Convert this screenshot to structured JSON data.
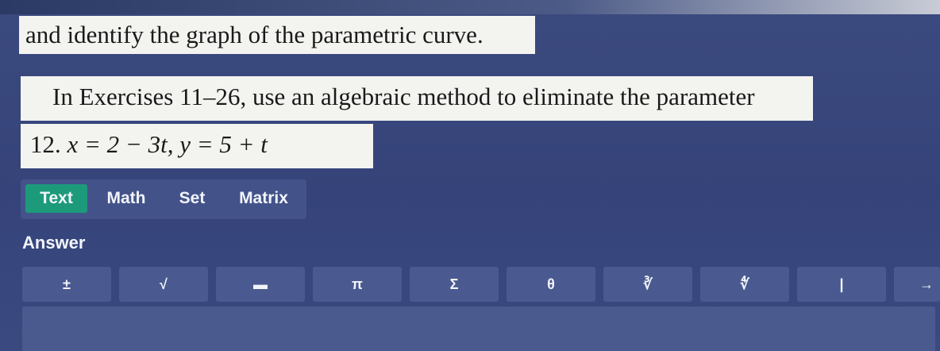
{
  "question": {
    "line1": "and identify the graph of the parametric curve.",
    "line2": "In Exercises 11–26, use an algebraic method to eliminate the parameter",
    "exercise_number": "12.",
    "exercise_equation": "x = 2 − 3t, y = 5 + t"
  },
  "tabs": [
    {
      "label": "Text",
      "active": true
    },
    {
      "label": "Math",
      "active": false
    },
    {
      "label": "Set",
      "active": false
    },
    {
      "label": "Matrix",
      "active": false
    }
  ],
  "answer": {
    "label": "Answer",
    "value": ""
  },
  "toolbar": {
    "keys": [
      "±",
      "√",
      "▬",
      "π",
      "Σ",
      "θ",
      "∛",
      "∜",
      "|",
      "→"
    ]
  },
  "colors": {
    "background": "#3b4a7e",
    "active_tab": "#1d9a7a",
    "key": "#4a5a90",
    "snippet": "#f3f3f0"
  }
}
